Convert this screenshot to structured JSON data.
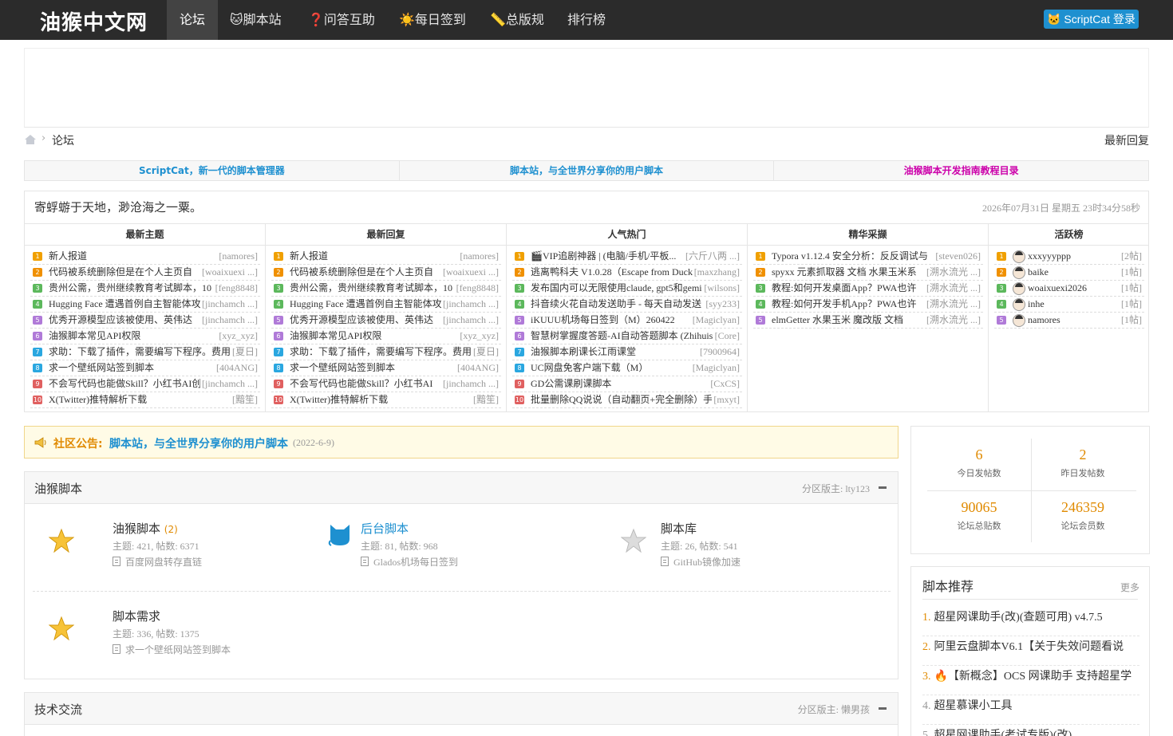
{
  "nav": {
    "logo": "油猴中文网",
    "items": [
      "论坛",
      "🐱脚本站",
      "❓问答互助",
      "☀️每日签到",
      "📏总版规",
      "排行榜"
    ],
    "login": "ScriptCat 登录"
  },
  "breadcrumb": {
    "current": "论坛",
    "latest_reply": "最新回复"
  },
  "links": [
    {
      "label": "ScriptCat，新一代的脚本管理器",
      "color": "#1e90d0"
    },
    {
      "label": "脚本站，与全世界分享你的用户脚本",
      "color": "#1e90d0"
    },
    {
      "label": "油猴脚本开发指南教程目录",
      "color": "#cc00aa"
    }
  ],
  "hot": {
    "slogan": "寄蜉蝣于天地，渺沧海之一粟。",
    "clock": "2026年07月31日 星期五 23时34分58秒",
    "columns": [
      {
        "title": "最新主题",
        "rows": [
          {
            "t": "新人报道",
            "a": "[namores]"
          },
          {
            "t": "代码被系统删除但是在个人主页自",
            "a": "[woaixuexi ...]"
          },
          {
            "t": "贵州公需，贵州继续教育考试脚本，10",
            "a": "[feng8848]"
          },
          {
            "t": "Hugging Face 遭遇首例自主智能体攻",
            "a": "[jinchamch ...]"
          },
          {
            "t": "优秀开源模型应该被使用、英伟达",
            "a": "[jinchamch ...]"
          },
          {
            "t": "油猴脚本常见API权限",
            "a": "[xyz_xyz]"
          },
          {
            "t": "求助：下载了插件，需要编写下程序。费用",
            "a": "[夏日]"
          },
          {
            "t": "求一个壁纸网站签到脚本",
            "a": "[404ANG]"
          },
          {
            "t": "不会写代码也能做Skill？小红书AI创",
            "a": "[jinchamch ...]"
          },
          {
            "t": "X(Twitter)推特解析下载",
            "a": "[黯笙]"
          }
        ]
      },
      {
        "title": "最新回复",
        "rows": [
          {
            "t": "新人报道",
            "a": "[namores]"
          },
          {
            "t": "代码被系统删除但是在个人主页自",
            "a": "[woaixuexi ...]"
          },
          {
            "t": "贵州公需，贵州继续教育考试脚本，10",
            "a": "[feng8848]"
          },
          {
            "t": "Hugging Face 遭遇首例自主智能体攻",
            "a": "[jinchamch ...]"
          },
          {
            "t": "优秀开源模型应该被使用、英伟达",
            "a": "[jinchamch ...]"
          },
          {
            "t": "油猴脚本常见API权限",
            "a": "[xyz_xyz]"
          },
          {
            "t": "求助：下载了插件，需要编写下程序。费用",
            "a": "[夏日]"
          },
          {
            "t": "求一个壁纸网站签到脚本",
            "a": "[404ANG]"
          },
          {
            "t": "不会写代码也能做Skill？小红书AI",
            "a": "[jinchamch ...]"
          },
          {
            "t": "X(Twitter)推特解析下载",
            "a": "[黯笙]"
          }
        ]
      },
      {
        "title": "人气热门",
        "rows": [
          {
            "t": "🎬VIP追剧神器 | (电脑/手机/平板...",
            "a": "[六斤八两 ...]"
          },
          {
            "t": "逃离鸭科夫 V1.0.28（Escape from Duck",
            "a": "[maxzhang]"
          },
          {
            "t": "发布国内可以无限使用claude, gpt5和gemi",
            "a": "[wilsons]"
          },
          {
            "t": "抖音续火花自动发送助手 - 每天自动发送",
            "a": "[syy233]"
          },
          {
            "t": "iKUUU机场每日签到（M）260422",
            "a": "[Magiclyan]"
          },
          {
            "t": "智慧树掌握度答题-AI自动答题脚本 (Zhihuis",
            "a": "[Core]"
          },
          {
            "t": "油猴脚本刷课长江雨课堂",
            "a": "[7900964]"
          },
          {
            "t": "UC网盘免客户端下载（M）",
            "a": "[Magiclyan]"
          },
          {
            "t": "GD公需课刷课脚本",
            "a": "[CxCS]"
          },
          {
            "t": "批量删除QQ说说（自动翻页+完全删除）手",
            "a": "[mxyt]"
          }
        ]
      },
      {
        "title": "精华采撷",
        "rows": [
          {
            "t": "Typora v1.12.4 安全分析：反反调试与",
            "a": "[steven026]"
          },
          {
            "t": "spyxx 元素抓取器 文档 水果玉米系",
            "a": "[溯水流光 ...]"
          },
          {
            "t": "教程:如何开发桌面App？PWA也许",
            "a": "[溯水流光 ...]"
          },
          {
            "t": "教程:如何开发手机App？PWA也许",
            "a": "[溯水流光 ...]"
          },
          {
            "t": "elmGetter 水果玉米 魔改版 文档",
            "a": "[溯水流光 ...]"
          }
        ]
      },
      {
        "title": "活跃榜",
        "rows": [
          {
            "t": "xxxyyyppp",
            "a": "[2帖]"
          },
          {
            "t": "baike",
            "a": "[1帖]"
          },
          {
            "t": "woaixuexi2026",
            "a": "[1帖]"
          },
          {
            "t": "inhe",
            "a": "[1帖]"
          },
          {
            "t": "namores",
            "a": "[1帖]"
          }
        ]
      }
    ],
    "rank_colors": [
      "#f0a000",
      "#f09000",
      "#5cb85c",
      "#5cb85c",
      "#b07ad8",
      "#b07ad8",
      "#2aa7e0",
      "#2aa7e0",
      "#e06060",
      "#e06060"
    ]
  },
  "notice": {
    "label": "社区公告:",
    "text": "脚本站，与全世界分享你的用户脚本",
    "date": "(2022-6-9)"
  },
  "sections": [
    {
      "title": "油猴脚本",
      "moderator": "分区版主: lty123",
      "forums": [
        {
          "name": "油猴脚本",
          "count": "(2)",
          "icon": "star-icon",
          "stat": "主题: 421, 帖数: 6371",
          "last": "百度网盘转存直链"
        },
        {
          "name": "后台脚本",
          "count": "",
          "icon": "scriptcat-icon",
          "stat": "主题: 81, 帖数: 968",
          "last": "Glados机场每日签到"
        },
        {
          "name": "脚本库",
          "count": "",
          "icon": "star-gray-icon",
          "stat": "主题: 26, 帖数: 541",
          "last": "GitHub镜像加速"
        },
        {
          "name": "脚本需求",
          "count": "",
          "icon": "star-icon",
          "stat": "主题: 336, 帖数: 1375",
          "last": "求一个壁纸网站签到脚本"
        }
      ]
    },
    {
      "title": "技术交流",
      "moderator": "分区版主: 懒男孩"
    }
  ],
  "stats": {
    "today": {
      "value": "6",
      "label": "今日发帖数"
    },
    "yesterday": {
      "value": "2",
      "label": "昨日发帖数"
    },
    "posts": {
      "value": "90065",
      "label": "论坛总贴数"
    },
    "members": {
      "value": "246359",
      "label": "论坛会员数"
    }
  },
  "recommend": {
    "title": "脚本推荐",
    "more": "更多",
    "items": [
      {
        "n": "1.",
        "t": "超星网课助手(改)(查题可用) v4.7.5"
      },
      {
        "n": "2.",
        "t": "阿里云盘脚本V6.1【关于失效问题看说"
      },
      {
        "n": "3.",
        "t": "🔥【新概念】OCS 网课助手 支持超星学"
      },
      {
        "n": "4.",
        "t": "超星慕课小工具"
      },
      {
        "n": "5.",
        "t": "超星网课助手(考试专版)(改)"
      }
    ]
  }
}
